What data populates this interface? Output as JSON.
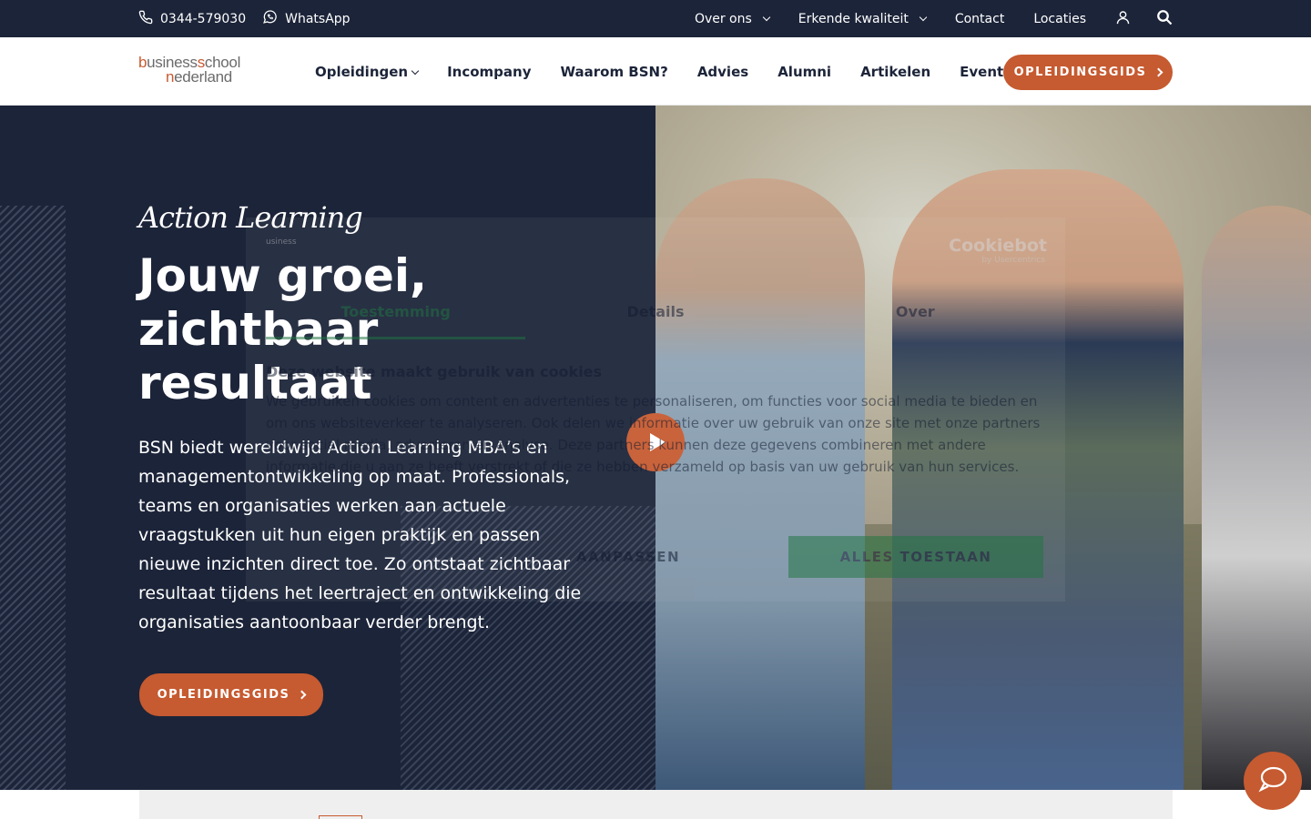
{
  "topbar": {
    "phone": "0344-579030",
    "whatsapp": "WhatsApp",
    "links": [
      "Over ons",
      "Erkende kwaliteit",
      "Contact",
      "Locaties"
    ]
  },
  "header": {
    "logo_line1_a": "b",
    "logo_line1_b": "usiness",
    "logo_line1_c": "s",
    "logo_line1_d": "chool",
    "logo_line2_a": "n",
    "logo_line2_b": "ederland",
    "nav": [
      "Opleidingen",
      "Incompany",
      "Waarom BSN?",
      "Advies",
      "Alumni",
      "Artikelen",
      "Events"
    ],
    "cta": "OPLEIDINGSGIDS"
  },
  "hero": {
    "script": "Action Learning",
    "headline": "Jouw groei, zichtbaar resultaat",
    "lead": "BSN biedt wereldwijd Action Learning MBA’s en managementontwikkeling op maat. Professionals, teams en organisaties werken aan actuele vraagstukken uit hun eigen praktijk en passen nieuwe inzichten direct toe. Zo ontstaat zichtbaar resultaat tijdens het leertraject en ontwikkeling die organisaties aantoonbaar verder brengt.",
    "cta": "OPLEIDINGSGIDS"
  },
  "cookie": {
    "brand": "Cookiebot",
    "brand_sub": "by Usercentrics",
    "tabs": [
      "Toestemming",
      "Details",
      "Over"
    ],
    "title": "Deze website maakt gebruik van cookies",
    "body": "We gebruiken cookies om content en advertenties te personaliseren, om functies voor social media te bieden en om ons websiteverkeer te analyseren. Ook delen we informatie over uw gebruik van onze site met onze partners voor social media, adverteren en analyse. Deze partners kunnen deze gegevens combineren met andere informatie die u aan ze heeft verstrekt of die ze hebben verzameld op basis van uw gebruik van hun services.",
    "btn_select": "AANPASSEN",
    "btn_all": "ALLES TOESTAAN"
  },
  "colors": {
    "navy": "#1c2439",
    "accent": "#c65a30",
    "cookie_green": "#2a7c4a"
  },
  "icons": [
    "phone-icon",
    "whatsapp-icon",
    "user-icon",
    "search-icon",
    "play-icon",
    "chat-icon"
  ]
}
